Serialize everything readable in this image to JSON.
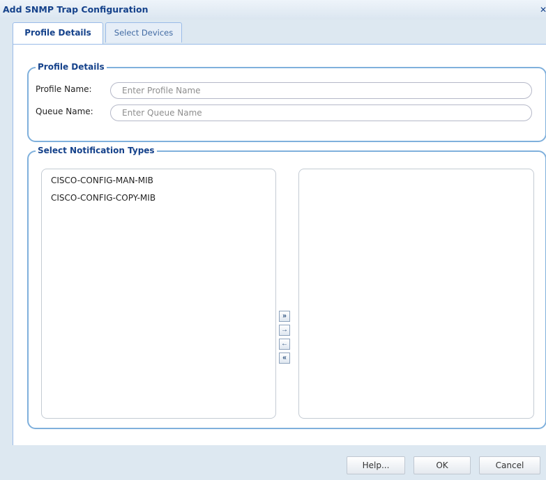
{
  "dialog": {
    "title": "Add SNMP Trap Configuration",
    "close_glyph": "✕"
  },
  "tabs": [
    {
      "label": "Profile Details",
      "active": true
    },
    {
      "label": "Select Devices",
      "active": false
    }
  ],
  "profile_details": {
    "legend": "Profile Details",
    "profile_name": {
      "label": "Profile Name:",
      "value": "",
      "placeholder": "Enter Profile Name"
    },
    "queue_name": {
      "label": "Queue Name:",
      "value": "",
      "placeholder": "Enter Queue Name"
    }
  },
  "notification_types": {
    "legend": "Select Notification Types",
    "available": [
      "CISCO-CONFIG-MAN-MIB",
      "CISCO-CONFIG-COPY-MIB"
    ],
    "selected": [],
    "move_buttons": {
      "add_all": "»",
      "add": "→",
      "remove": "←",
      "remove_all": "«"
    }
  },
  "footer": {
    "help_label": "Help...",
    "ok_label": "OK",
    "cancel_label": "Cancel"
  },
  "colors": {
    "title_text": "#15428b",
    "fieldset_border": "#7fb0dc",
    "dialog_background": "#dde8f1"
  }
}
